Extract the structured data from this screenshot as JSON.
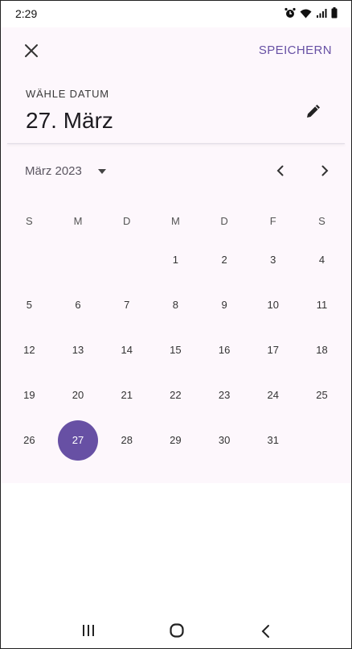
{
  "status_bar": {
    "time": "2:29",
    "icons": [
      "alarm-icon",
      "wifi-icon",
      "signal-icon",
      "battery-icon"
    ]
  },
  "toolbar": {
    "close_icon": "close-icon",
    "save_label": "SPEICHERN"
  },
  "header": {
    "label": "WÄHLE DATUM",
    "selected_date": "27. März",
    "edit_icon": "pencil-icon"
  },
  "calendar": {
    "month_label": "März 2023",
    "weekdays": [
      "S",
      "M",
      "D",
      "M",
      "D",
      "F",
      "S"
    ],
    "weeks": [
      [
        "",
        "",
        "",
        "1",
        "2",
        "3",
        "4"
      ],
      [
        "5",
        "6",
        "7",
        "8",
        "9",
        "10",
        "11"
      ],
      [
        "12",
        "13",
        "14",
        "15",
        "16",
        "17",
        "18"
      ],
      [
        "19",
        "20",
        "21",
        "22",
        "23",
        "24",
        "25"
      ],
      [
        "26",
        "27",
        "28",
        "29",
        "30",
        "31",
        ""
      ]
    ],
    "selected_day": "27"
  },
  "colors": {
    "accent": "#6750a4",
    "surface": "#fdf7fc"
  },
  "nav_bar": {
    "icons": [
      "recent-apps-icon",
      "home-icon",
      "back-icon"
    ]
  }
}
